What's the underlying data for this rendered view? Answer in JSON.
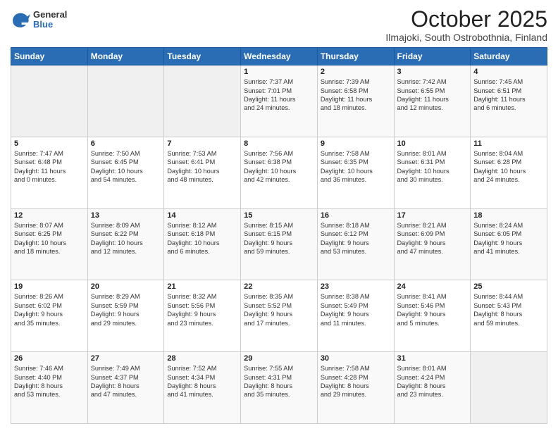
{
  "logo": {
    "general": "General",
    "blue": "Blue"
  },
  "title": "October 2025",
  "subtitle": "Ilmajoki, South Ostrobothnia, Finland",
  "weekdays": [
    "Sunday",
    "Monday",
    "Tuesday",
    "Wednesday",
    "Thursday",
    "Friday",
    "Saturday"
  ],
  "weeks": [
    [
      {
        "day": "",
        "content": ""
      },
      {
        "day": "",
        "content": ""
      },
      {
        "day": "",
        "content": ""
      },
      {
        "day": "1",
        "content": "Sunrise: 7:37 AM\nSunset: 7:01 PM\nDaylight: 11 hours\nand 24 minutes."
      },
      {
        "day": "2",
        "content": "Sunrise: 7:39 AM\nSunset: 6:58 PM\nDaylight: 11 hours\nand 18 minutes."
      },
      {
        "day": "3",
        "content": "Sunrise: 7:42 AM\nSunset: 6:55 PM\nDaylight: 11 hours\nand 12 minutes."
      },
      {
        "day": "4",
        "content": "Sunrise: 7:45 AM\nSunset: 6:51 PM\nDaylight: 11 hours\nand 6 minutes."
      }
    ],
    [
      {
        "day": "5",
        "content": "Sunrise: 7:47 AM\nSunset: 6:48 PM\nDaylight: 11 hours\nand 0 minutes."
      },
      {
        "day": "6",
        "content": "Sunrise: 7:50 AM\nSunset: 6:45 PM\nDaylight: 10 hours\nand 54 minutes."
      },
      {
        "day": "7",
        "content": "Sunrise: 7:53 AM\nSunset: 6:41 PM\nDaylight: 10 hours\nand 48 minutes."
      },
      {
        "day": "8",
        "content": "Sunrise: 7:56 AM\nSunset: 6:38 PM\nDaylight: 10 hours\nand 42 minutes."
      },
      {
        "day": "9",
        "content": "Sunrise: 7:58 AM\nSunset: 6:35 PM\nDaylight: 10 hours\nand 36 minutes."
      },
      {
        "day": "10",
        "content": "Sunrise: 8:01 AM\nSunset: 6:31 PM\nDaylight: 10 hours\nand 30 minutes."
      },
      {
        "day": "11",
        "content": "Sunrise: 8:04 AM\nSunset: 6:28 PM\nDaylight: 10 hours\nand 24 minutes."
      }
    ],
    [
      {
        "day": "12",
        "content": "Sunrise: 8:07 AM\nSunset: 6:25 PM\nDaylight: 10 hours\nand 18 minutes."
      },
      {
        "day": "13",
        "content": "Sunrise: 8:09 AM\nSunset: 6:22 PM\nDaylight: 10 hours\nand 12 minutes."
      },
      {
        "day": "14",
        "content": "Sunrise: 8:12 AM\nSunset: 6:18 PM\nDaylight: 10 hours\nand 6 minutes."
      },
      {
        "day": "15",
        "content": "Sunrise: 8:15 AM\nSunset: 6:15 PM\nDaylight: 9 hours\nand 59 minutes."
      },
      {
        "day": "16",
        "content": "Sunrise: 8:18 AM\nSunset: 6:12 PM\nDaylight: 9 hours\nand 53 minutes."
      },
      {
        "day": "17",
        "content": "Sunrise: 8:21 AM\nSunset: 6:09 PM\nDaylight: 9 hours\nand 47 minutes."
      },
      {
        "day": "18",
        "content": "Sunrise: 8:24 AM\nSunset: 6:05 PM\nDaylight: 9 hours\nand 41 minutes."
      }
    ],
    [
      {
        "day": "19",
        "content": "Sunrise: 8:26 AM\nSunset: 6:02 PM\nDaylight: 9 hours\nand 35 minutes."
      },
      {
        "day": "20",
        "content": "Sunrise: 8:29 AM\nSunset: 5:59 PM\nDaylight: 9 hours\nand 29 minutes."
      },
      {
        "day": "21",
        "content": "Sunrise: 8:32 AM\nSunset: 5:56 PM\nDaylight: 9 hours\nand 23 minutes."
      },
      {
        "day": "22",
        "content": "Sunrise: 8:35 AM\nSunset: 5:52 PM\nDaylight: 9 hours\nand 17 minutes."
      },
      {
        "day": "23",
        "content": "Sunrise: 8:38 AM\nSunset: 5:49 PM\nDaylight: 9 hours\nand 11 minutes."
      },
      {
        "day": "24",
        "content": "Sunrise: 8:41 AM\nSunset: 5:46 PM\nDaylight: 9 hours\nand 5 minutes."
      },
      {
        "day": "25",
        "content": "Sunrise: 8:44 AM\nSunset: 5:43 PM\nDaylight: 8 hours\nand 59 minutes."
      }
    ],
    [
      {
        "day": "26",
        "content": "Sunrise: 7:46 AM\nSunset: 4:40 PM\nDaylight: 8 hours\nand 53 minutes."
      },
      {
        "day": "27",
        "content": "Sunrise: 7:49 AM\nSunset: 4:37 PM\nDaylight: 8 hours\nand 47 minutes."
      },
      {
        "day": "28",
        "content": "Sunrise: 7:52 AM\nSunset: 4:34 PM\nDaylight: 8 hours\nand 41 minutes."
      },
      {
        "day": "29",
        "content": "Sunrise: 7:55 AM\nSunset: 4:31 PM\nDaylight: 8 hours\nand 35 minutes."
      },
      {
        "day": "30",
        "content": "Sunrise: 7:58 AM\nSunset: 4:28 PM\nDaylight: 8 hours\nand 29 minutes."
      },
      {
        "day": "31",
        "content": "Sunrise: 8:01 AM\nSunset: 4:24 PM\nDaylight: 8 hours\nand 23 minutes."
      },
      {
        "day": "",
        "content": ""
      }
    ]
  ]
}
